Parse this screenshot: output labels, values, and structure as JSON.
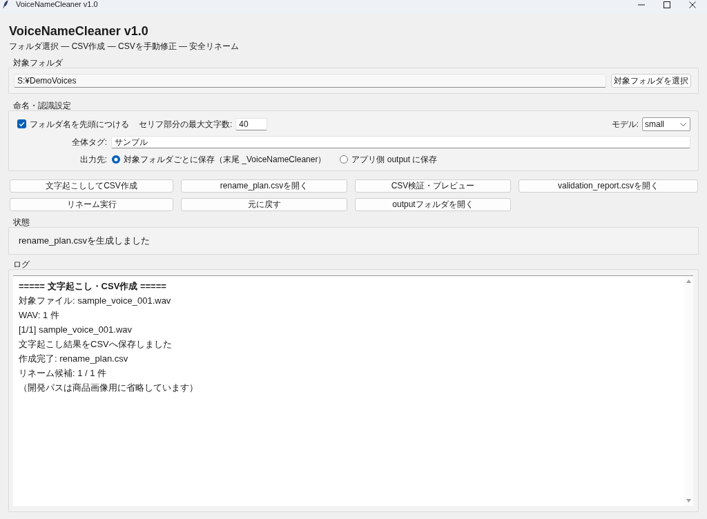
{
  "window": {
    "title": "VoiceNameCleaner v1.0"
  },
  "app_title": "VoiceNameCleaner v1.0",
  "subtitle": "フォルダ選択 — CSV作成 — CSVを手動修正 — 安全リネーム",
  "folder": {
    "label": "対象フォルダ",
    "path": "S:¥DemoVoices",
    "button": "対象フォルダを選択"
  },
  "settings": {
    "label": "命名・認識設定",
    "prefix_folder": {
      "label": "フォルダ名を先頭につける",
      "checked": true
    },
    "max_chars": {
      "label": "セリフ部分の最大文字数:",
      "value": "40"
    },
    "model": {
      "label": "モデル:",
      "value": "small"
    },
    "tag": {
      "label": "全体タグ:",
      "value": "サンプル"
    },
    "output": {
      "label": "出力先:",
      "options": [
        {
          "label": "対象フォルダごとに保存（末尾 _VoiceNameCleaner）",
          "selected": true
        },
        {
          "label": "アプリ側 output に保存",
          "selected": false
        }
      ]
    }
  },
  "actions": [
    "文字起こししてCSV作成",
    "rename_plan.csvを開く",
    "CSV検証・プレビュー",
    "validation_report.csvを開く",
    "リネーム実行",
    "元に戻す",
    "outputフォルダを開く"
  ],
  "status": {
    "label": "状態",
    "message": "rename_plan.csvを生成しました"
  },
  "log": {
    "label": "ログ",
    "lines": [
      {
        "kind": "heading",
        "text": "===== 文字起こし・CSV作成 ====="
      },
      {
        "kind": "plain",
        "text": "対象ファイル: sample_voice_001.wav"
      },
      {
        "kind": "plain",
        "text": "WAV: 1 件"
      },
      {
        "kind": "plain",
        "text": "[1/1] sample_voice_001.wav"
      },
      {
        "kind": "plain",
        "text": "文字起こし結果をCSVへ保存しました"
      },
      {
        "kind": "plain",
        "text": "作成完了: rename_plan.csv"
      },
      {
        "kind": "plain",
        "text": "リネーム候補: 1 / 1 件"
      },
      {
        "kind": "plain",
        "text": "（開発パスは商品画像用に省略しています）"
      }
    ]
  }
}
